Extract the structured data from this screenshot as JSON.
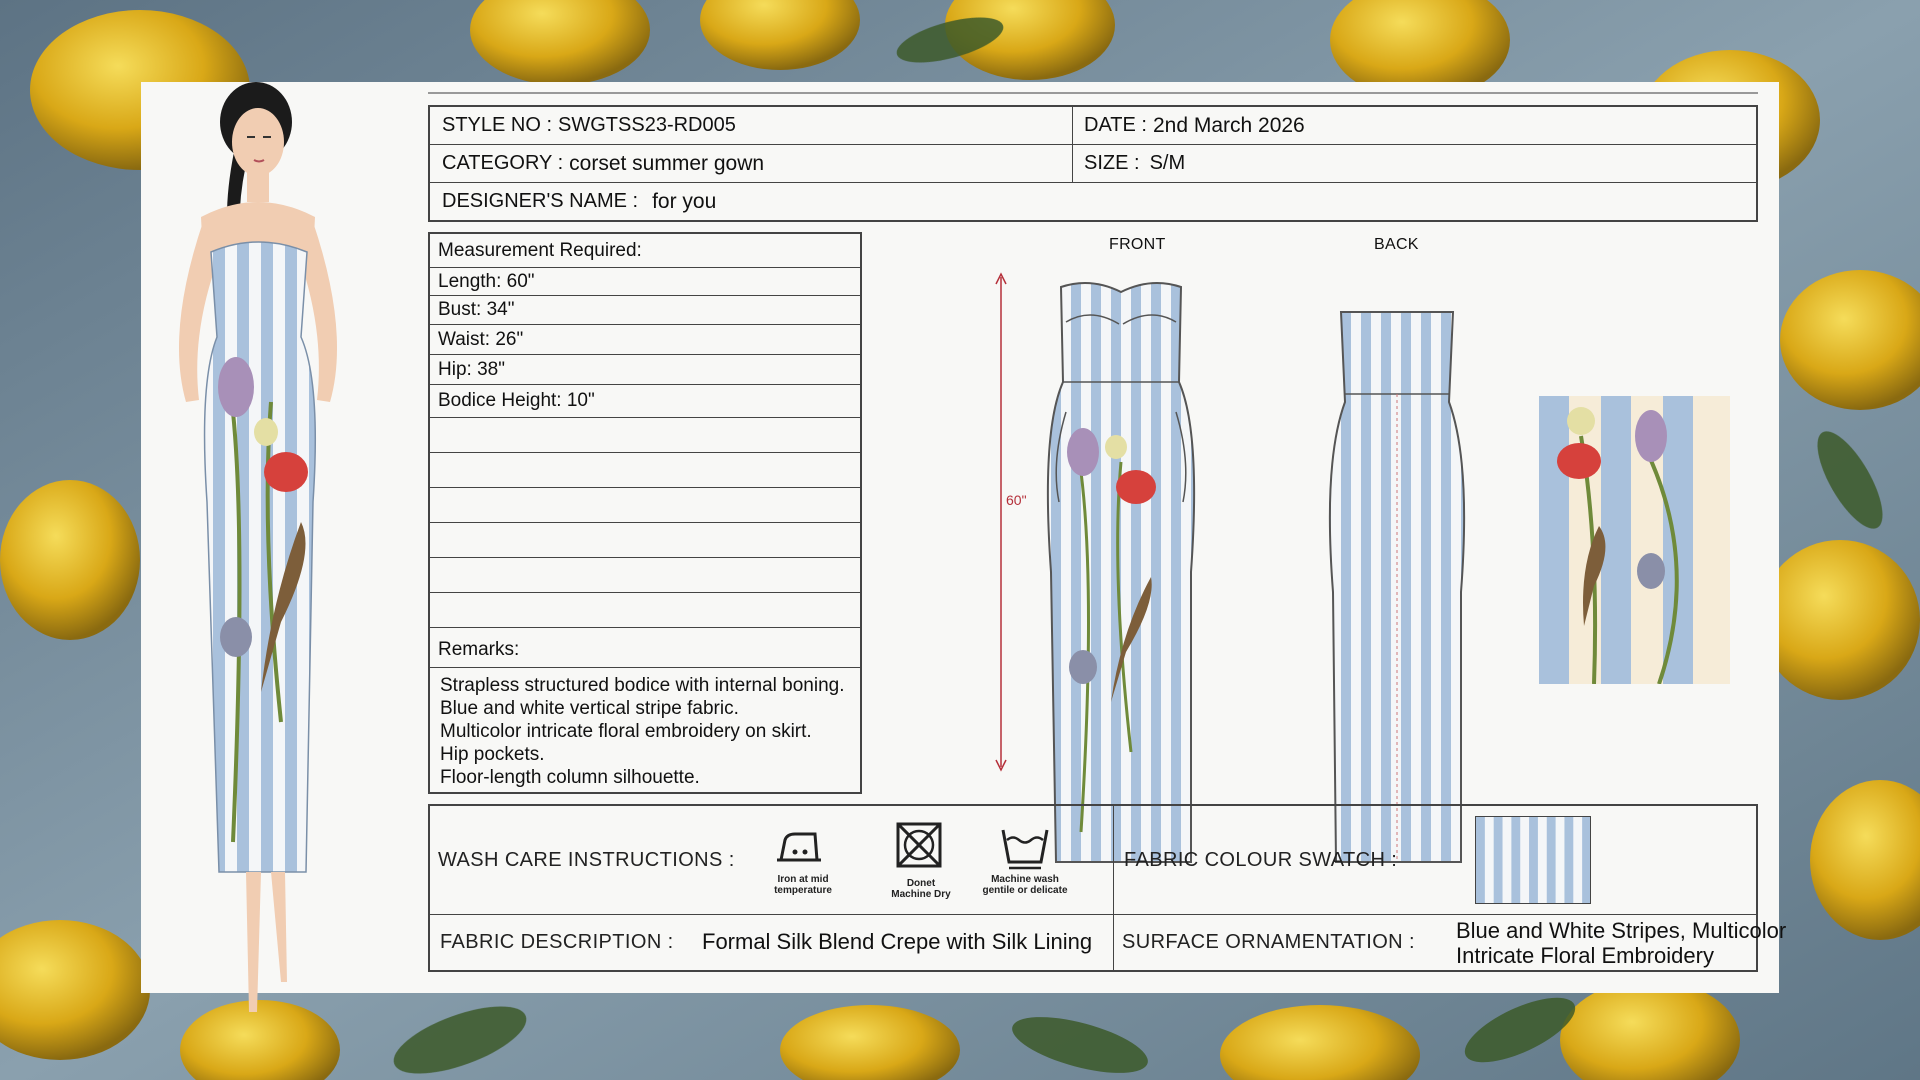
{
  "header": {
    "style_no_label": "STYLE NO :",
    "style_no": "SWGTSS23-RD005",
    "date_label": "DATE :",
    "date": "2nd March 2026",
    "category_label": "CATEGORY :",
    "category": "corset summer gown",
    "size_label": "SIZE :",
    "size": "S/M",
    "designer_label": "DESIGNER'S NAME :",
    "designer": "for you"
  },
  "measurements": {
    "title": "Measurement Required:",
    "items": [
      "Length: 60\"",
      "Bust: 34\"",
      "Waist: 26\"",
      "Hip: 38\"",
      "Bodice Height: 10\""
    ]
  },
  "remarks": {
    "title": "Remarks:",
    "lines": [
      "Strapless structured bodice with internal boning.",
      "Blue and white vertical stripe fabric.",
      "Multicolor intricate floral embroidery on skirt.",
      "Hip pockets.",
      "Floor-length column silhouette."
    ]
  },
  "flats": {
    "front_label": "FRONT",
    "back_label": "BACK",
    "length_marker": "60\""
  },
  "wash_care": {
    "label": "WASH CARE INSTRUCTIONS :",
    "icons": [
      {
        "icon": "iron-icon",
        "text_1": "Iron at mid",
        "text_2": "temperature"
      },
      {
        "icon": "no-machine-dry-icon",
        "text_1": "Donet",
        "text_2": "Machine Dry"
      },
      {
        "icon": "machine-wash-icon",
        "text_1": "Machine wash",
        "text_2": "gentile or delicate"
      }
    ]
  },
  "fabric_colour_swatch_label": "FABRIC COLOUR SWATCH :",
  "fabric_description": {
    "label": "FABRIC DESCRIPTION :",
    "value": "Formal Silk Blend Crepe with Silk Lining"
  },
  "surface_ornamentation": {
    "label": "SURFACE ORNAMENTATION :",
    "value_line_1": "Blue and White Stripes, Multicolor",
    "value_line_2": "Intricate Floral Embroidery"
  },
  "colors": {
    "stripe_blue": "#a9c1dc",
    "stripe_white": "#f4f6f8",
    "dimension_red": "#b5303a",
    "background_slate": "#6f8798",
    "lemon_yellow": "#e2b51c"
  }
}
